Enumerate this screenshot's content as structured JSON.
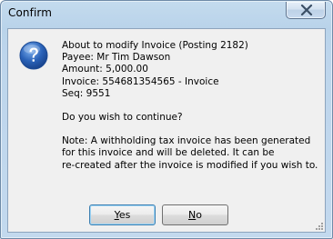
{
  "window": {
    "title": "Confirm"
  },
  "message": {
    "line1": "About to modify Invoice (Posting 2182)",
    "line2": "Payee: Mr Tim Dawson",
    "line3": "Amount: 5,000.00",
    "line4": "Invoice: 554681354565 - Invoice",
    "line5": "Seq: 9551",
    "question": "Do you wish to continue?",
    "note1": "Note: A withholding tax invoice has been generated",
    "note2": "for this invoice and will be deleted.  It can be",
    "note3": "re-created after the invoice is modified if you wish to."
  },
  "buttons": {
    "yes_accel": "Y",
    "yes_rest": "es",
    "no_accel": "N",
    "no_rest": "o"
  },
  "icons": {
    "dialog": "question-icon",
    "close": "close-icon"
  },
  "colors": {
    "window_frame": "#bdd5ec",
    "client_bg": "#f0f0f0",
    "icon_blue": "#2a62b8"
  }
}
